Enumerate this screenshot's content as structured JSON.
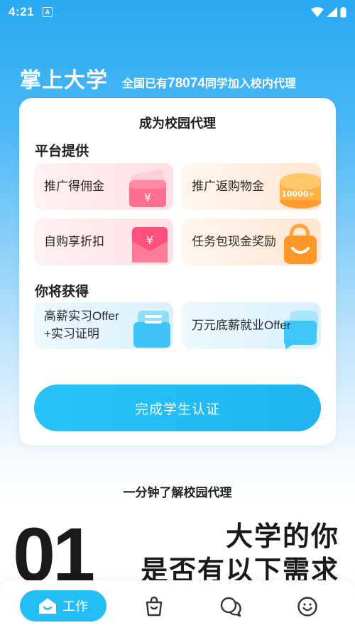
{
  "status_bar": {
    "time": "4:21",
    "notification_badge": "A"
  },
  "header": {
    "app_title": "掌上大学",
    "tagline_prefix": "全国已有",
    "member_count": "78074",
    "tagline_suffix": "同学加入校内代理"
  },
  "card": {
    "title": "成为校园代理",
    "platform_section": {
      "heading": "平台提供",
      "tiles": [
        {
          "label": "推广得佣金",
          "icon": "wallet-cash-icon"
        },
        {
          "label": "推广返购物金",
          "icon": "coin-10000-icon",
          "badge": "10000+"
        },
        {
          "label": "自购享折扣",
          "icon": "red-envelope-icon"
        },
        {
          "label": "任务包现金奖励",
          "icon": "shopping-bag-icon"
        }
      ]
    },
    "benefit_section": {
      "heading": "你将获得",
      "tiles": [
        {
          "label_line1": "高薪实习Offer",
          "label_line2": "+实习证明",
          "icon": "certificate-folder-icon"
        },
        {
          "label": "万元底薪就业Offer",
          "icon": "chat-bubble-icon"
        }
      ]
    },
    "cta_label": "完成学生认证"
  },
  "intro": {
    "title": "一分钟了解校园代理",
    "step_number": "01",
    "step_heading": "大学的你",
    "step_subheading": "是否有以下需求"
  },
  "tab_bar": {
    "active_label": "工作",
    "tabs": [
      "work-home-icon",
      "shopping-bag-tab-icon",
      "chat-tab-icon",
      "smiley-tab-icon"
    ]
  },
  "colors": {
    "primary": "#25bdf5",
    "header_blue": "#29a9f3"
  }
}
